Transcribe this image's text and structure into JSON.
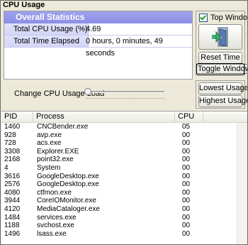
{
  "window": {
    "title": "CPU Usage"
  },
  "stats": {
    "header": "Overall Statistics",
    "rows": [
      {
        "label": "Total CPU Usage (%)",
        "value": "4.69"
      },
      {
        "label": "Total Time Elapsed",
        "value": "0 hours, 0 minutes, 49 seconds"
      }
    ]
  },
  "controls": {
    "top_window_label": "Top Window",
    "top_window_checked": true,
    "reset_time_label": "Reset Time",
    "toggle_window_label": "Toggle Window",
    "change_load_label": "Change CPU Usage Load",
    "slider_value": 0,
    "lowest_usage_label": "Lowest Usage",
    "highest_usage_label": "Highest Usage"
  },
  "process_list": {
    "columns": {
      "pid": "PID",
      "process": "Process",
      "cpu": "CPU"
    },
    "rows": [
      {
        "pid": "1460",
        "process": "CNCBender.exe",
        "cpu": "05"
      },
      {
        "pid": "928",
        "process": "avp.exe",
        "cpu": "00"
      },
      {
        "pid": "728",
        "process": "acs.exe",
        "cpu": "00"
      },
      {
        "pid": "3308",
        "process": "Explorer.EXE",
        "cpu": "00"
      },
      {
        "pid": "2168",
        "process": "point32.exe",
        "cpu": "00"
      },
      {
        "pid": "4",
        "process": "System",
        "cpu": "00"
      },
      {
        "pid": "3616",
        "process": "GoogleDesktop.exe",
        "cpu": "00"
      },
      {
        "pid": "2576",
        "process": "GoogleDesktop.exe",
        "cpu": "00"
      },
      {
        "pid": "4080",
        "process": "ctfmon.exe",
        "cpu": "00"
      },
      {
        "pid": "3944",
        "process": "CoreIOMonitor.exe",
        "cpu": "00"
      },
      {
        "pid": "4120",
        "process": "MediaCataloger.exe",
        "cpu": "00"
      },
      {
        "pid": "1484",
        "process": "services.exe",
        "cpu": "00"
      },
      {
        "pid": "1188",
        "process": "svchost.exe",
        "cpu": "00"
      },
      {
        "pid": "1496",
        "process": "lsass.exe",
        "cpu": "00"
      }
    ]
  }
}
